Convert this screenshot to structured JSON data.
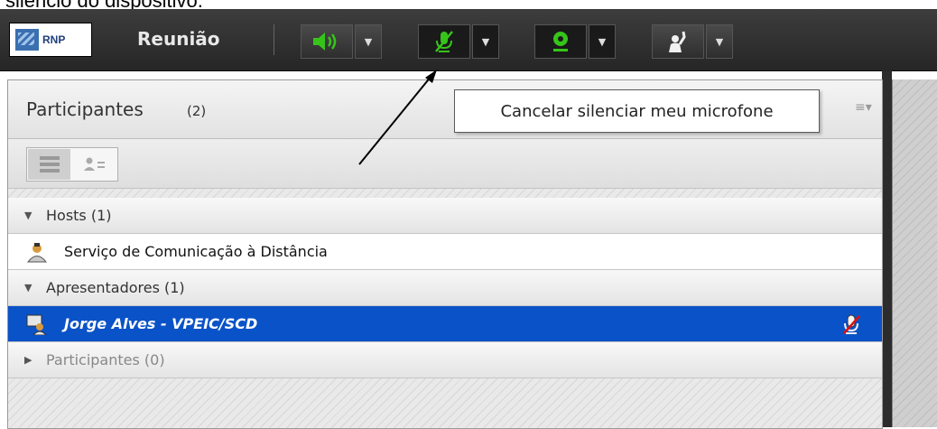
{
  "caption": "silencio do dispositivo.",
  "app": {
    "logo_text": "RNP",
    "title": "Reunião"
  },
  "toolbar": {
    "speaker_icon": "speaker-icon",
    "mic_icon": "microphone-muted-icon",
    "webcam_icon": "webcam-icon",
    "hand_icon": "raise-hand-icon",
    "accent_green": "#36c41a"
  },
  "tooltip": {
    "text": "Cancelar silenciar meu microfone"
  },
  "panel": {
    "title": "Participantes",
    "count": "(2)",
    "groups": [
      {
        "label": "Hosts (1)",
        "members": [
          {
            "name": "Serviço de Comunicação à Distância",
            "selected": false
          }
        ]
      },
      {
        "label": "Apresentadores (1)",
        "members": [
          {
            "name": "Jorge Alves - VPEIC/SCD",
            "selected": true,
            "mic_status": "muted"
          }
        ]
      },
      {
        "label": "Participantes (0)",
        "members": []
      }
    ]
  },
  "colors": {
    "selection": "#0a52c8",
    "appbar": "#2e2e2e"
  }
}
